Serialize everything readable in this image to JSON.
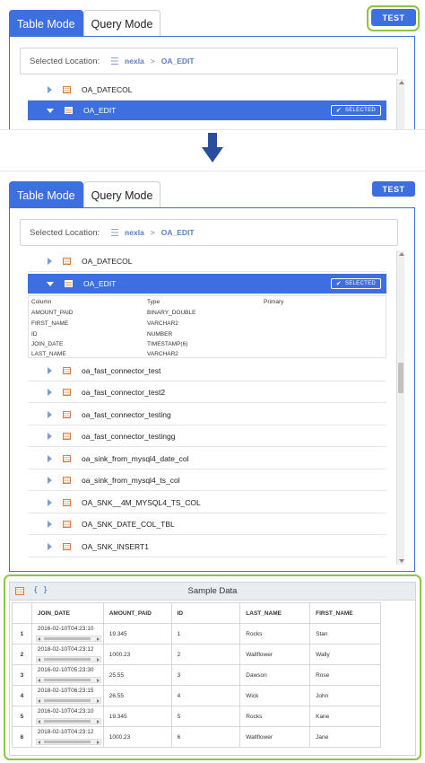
{
  "tabs": {
    "table_mode": "Table Mode",
    "query_mode": "Query Mode"
  },
  "test_button": "TEST",
  "location": {
    "label": "Selected Location:",
    "database": "nexla",
    "separator": ">",
    "table": "OA_EDIT"
  },
  "top_panel": {
    "rows": [
      {
        "name": "OA_DATECOL"
      },
      {
        "name": "OA_EDIT",
        "badge": "SELECTED"
      }
    ]
  },
  "bottom_panel": {
    "rows_before": [
      {
        "name": "OA_DATECOL"
      }
    ],
    "selected": {
      "name": "OA_EDIT",
      "badge": "SELECTED",
      "schema_headers": [
        "Column",
        "Type",
        "Primary"
      ],
      "schema": [
        {
          "column": "AMOUNT_PAID",
          "type": "BINARY_DOUBLE"
        },
        {
          "column": "FIRST_NAME",
          "type": "VARCHAR2"
        },
        {
          "column": "ID",
          "type": "NUMBER"
        },
        {
          "column": "JOIN_DATE",
          "type": "TIMESTAMP(6)"
        },
        {
          "column": "LAST_NAME",
          "type": "VARCHAR2"
        }
      ]
    },
    "rows_after": [
      {
        "name": "oa_fast_connector_test"
      },
      {
        "name": "oa_fast_connector_test2"
      },
      {
        "name": "oa_fast_connector_testing"
      },
      {
        "name": "oa_fast_connector_testingg"
      },
      {
        "name": "oa_sink_from_mysql4_date_col"
      },
      {
        "name": "oa_sink_from_mysql4_ts_col"
      },
      {
        "name": "OA_SNK__4M_MYSQL4_TS_COL"
      },
      {
        "name": "OA_SNK_DATE_COL_TBL"
      },
      {
        "name": "OA_SNK_INSERT1"
      }
    ]
  },
  "sample_data": {
    "title": "Sample Data",
    "json_toggle": "{ }",
    "headers": [
      "JOIN_DATE",
      "AMOUNT_PAID",
      "ID",
      "LAST_NAME",
      "FIRST_NAME"
    ],
    "rows": [
      {
        "idx": "1",
        "join_date": "2016-02-10T04:23:10",
        "amount_paid": "19.345",
        "id": "1",
        "last_name": "Rocks",
        "first_name": "Stan"
      },
      {
        "idx": "2",
        "join_date": "2018-02-10T04:23:12",
        "amount_paid": "1000.23",
        "id": "2",
        "last_name": "Wallflower",
        "first_name": "Wally"
      },
      {
        "idx": "3",
        "join_date": "2016-02-10T05:23:30",
        "amount_paid": "25.55",
        "id": "3",
        "last_name": "Dawson",
        "first_name": "Rose"
      },
      {
        "idx": "4",
        "join_date": "2018-02-10T06:23:15",
        "amount_paid": "26.55",
        "id": "4",
        "last_name": "Wick",
        "first_name": "John"
      },
      {
        "idx": "5",
        "join_date": "2016-02-10T04:23:10",
        "amount_paid": "19.345",
        "id": "5",
        "last_name": "Rocks",
        "first_name": "Kane"
      },
      {
        "idx": "6",
        "join_date": "2018-02-10T04:23:12",
        "amount_paid": "1000.23",
        "id": "6",
        "last_name": "Wallflower",
        "first_name": "Jane"
      }
    ]
  },
  "colors": {
    "accent": "#3d6fe0",
    "highlight": "#8cc63f",
    "table_icon": "#e07a3a"
  }
}
